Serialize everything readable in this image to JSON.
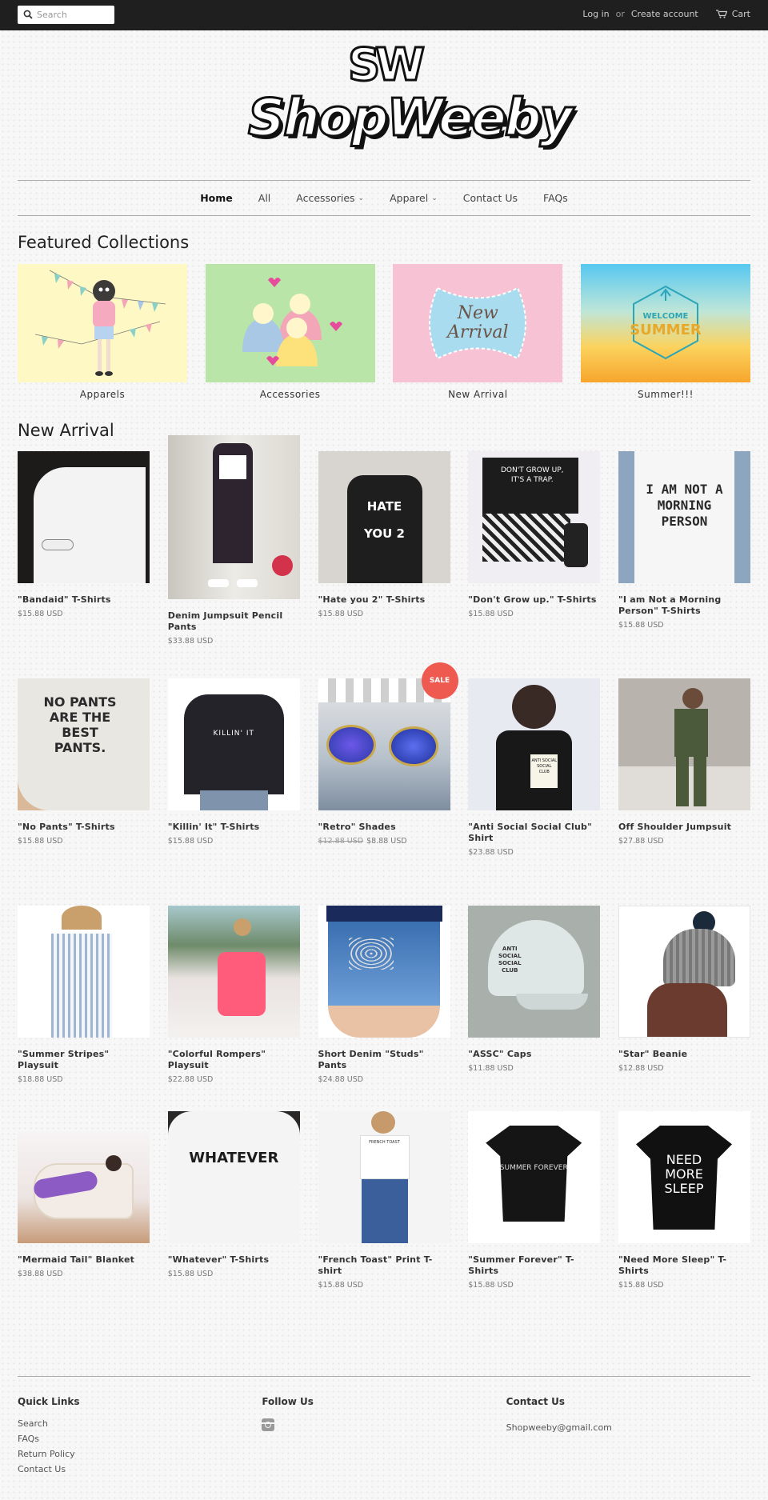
{
  "topbar": {
    "search_placeholder": "Search",
    "login_label": "Log in",
    "or_label": "or",
    "create_account_label": "Create account",
    "cart_label": "Cart"
  },
  "logo": {
    "mark": "SW",
    "text": "ShopWeeby"
  },
  "nav": {
    "items": [
      {
        "label": "Home",
        "active": true
      },
      {
        "label": "All"
      },
      {
        "label": "Accessories",
        "dropdown": true
      },
      {
        "label": "Apparel",
        "dropdown": true
      },
      {
        "label": "Contact Us"
      },
      {
        "label": "FAQs"
      }
    ]
  },
  "featured": {
    "title": "Featured Collections",
    "collections": [
      {
        "label": "Apparels"
      },
      {
        "label": "Accessories"
      },
      {
        "label": "New Arrival",
        "image_text": "New Arrival"
      },
      {
        "label": "Summer!!!",
        "image_text_1": "WELCOME",
        "image_text_2": "SUMMER"
      }
    ]
  },
  "new_arrival": {
    "title": "New Arrival",
    "products": [
      {
        "title": "\"Bandaid\" T-Shirts",
        "price": "$15.88 USD"
      },
      {
        "title": "Denim Jumpsuit Pencil Pants",
        "price": "$33.88 USD"
      },
      {
        "title": "\"Hate you 2\" T-Shirts",
        "price": "$15.88 USD",
        "image_text": "HATE YOU 2"
      },
      {
        "title": "\"Don't Grow up.\" T-Shirts",
        "price": "$15.88 USD",
        "image_text": "DON'T GROW UP, IT'S A TRAP."
      },
      {
        "title": "\"I am Not a Morning Person\" T-Shirts",
        "price": "$15.88 USD",
        "image_text": "I AM NOT A MORNING PERSON"
      },
      {
        "title": "\"No Pants\" T-Shirts",
        "price": "$15.88 USD",
        "image_text": "NO PANTS ARE THE BEST PANTS."
      },
      {
        "title": "\"Killin' It\" T-Shirts",
        "price": "$15.88 USD",
        "image_text": "KILLIN' IT"
      },
      {
        "title": "\"Retro\" Shades",
        "compare_price": "$12.88 USD",
        "price": "$8.88 USD",
        "badge": "SALE"
      },
      {
        "title": "\"Anti Social Social Club\" Shirt",
        "price": "$23.88 USD",
        "image_text": "ANTI SOCIAL SOCIAL CLUB"
      },
      {
        "title": "Off Shoulder Jumpsuit",
        "price": "$27.88 USD"
      },
      {
        "title": "\"Summer Stripes\" Playsuit",
        "price": "$18.88 USD"
      },
      {
        "title": "\"Colorful Rompers\" Playsuit",
        "price": "$22.88 USD"
      },
      {
        "title": "Short Denim \"Studs\" Pants",
        "price": "$24.88 USD"
      },
      {
        "title": "\"ASSC\" Caps",
        "price": "$11.88 USD",
        "image_text": "ANTI SOCIAL SOCIAL CLUB"
      },
      {
        "title": "\"Star\" Beanie",
        "price": "$12.88 USD"
      },
      {
        "title": "\"Mermaid Tail\" Blanket",
        "price": "$38.88 USD"
      },
      {
        "title": "\"Whatever\" T-Shirts",
        "price": "$15.88 USD",
        "image_text": "WHATEVER"
      },
      {
        "title": "\"French Toast\" Print T-shirt",
        "price": "$15.88 USD",
        "image_text": "FRENCH TOAST"
      },
      {
        "title": "\"Summer Forever\" T-Shirts",
        "price": "$15.88 USD",
        "image_text": "SUMMER FOREVER"
      },
      {
        "title": "\"Need More Sleep\" T-Shirts",
        "price": "$15.88 USD",
        "image_text": "NEED MORE SLEEP"
      }
    ]
  },
  "footer": {
    "quick_links_title": "Quick Links",
    "quick_links": [
      "Search",
      "FAQs",
      "Return Policy",
      "Contact Us"
    ],
    "follow_title": "Follow Us",
    "contact_title": "Contact Us",
    "email": "Shopweeby@gmail.com"
  },
  "colors": {
    "topbar": "#1f1f1f",
    "sale_badge": "#ef5a50",
    "page_bg": "#f7f7f7"
  }
}
